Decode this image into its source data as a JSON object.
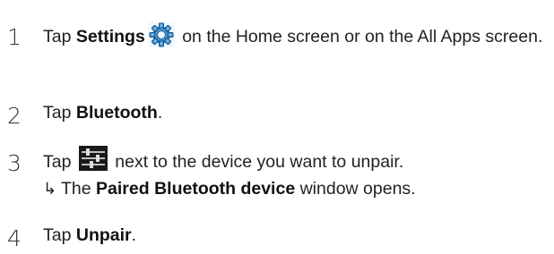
{
  "steps": [
    {
      "number": "1",
      "text_1": "Tap ",
      "bold_1": "Settings",
      "icon": "settings-gear-icon",
      "text_2": " on the Home screen or on the All Apps screen."
    },
    {
      "number": "2",
      "text_1": "Tap ",
      "bold_1": "Bluetooth",
      "text_2": "."
    },
    {
      "number": "3",
      "text_1": "Tap ",
      "icon": "sliders-settings-icon",
      "text_2": " next to the device you want to unpair.",
      "result_arrow": "↳",
      "result_text_1": "The ",
      "result_bold": "Paired Bluetooth device",
      "result_text_2": " window opens."
    },
    {
      "number": "4",
      "text_1": "Tap ",
      "bold_1": "Unpair",
      "text_2": "."
    }
  ]
}
